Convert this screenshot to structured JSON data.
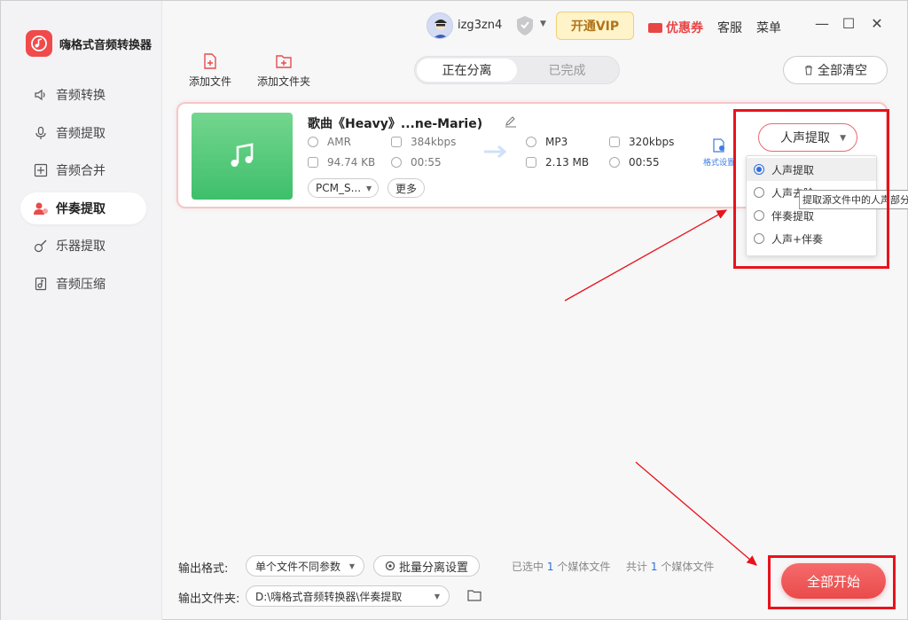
{
  "app": {
    "title": "嗨格式音频转换器"
  },
  "sidebar": {
    "items": [
      {
        "label": "音频转换",
        "icon": "speaker-icon"
      },
      {
        "label": "音频提取",
        "icon": "mic-icon"
      },
      {
        "label": "音频合并",
        "icon": "merge-icon"
      },
      {
        "label": "伴奏提取",
        "icon": "singer-icon",
        "active": true
      },
      {
        "label": "乐器提取",
        "icon": "guitar-icon"
      },
      {
        "label": "音频压缩",
        "icon": "compress-icon"
      }
    ]
  },
  "header": {
    "username": "izg3zn4",
    "vip_label": "开通VIP",
    "coupon_label": "优惠券",
    "service_label": "客服",
    "menu_label": "菜单"
  },
  "toolbar": {
    "add_file": "添加文件",
    "add_folder": "添加文件夹",
    "tabs": [
      "正在分离",
      "已完成"
    ],
    "active_tab": 0,
    "clear_all": "全部清空"
  },
  "file": {
    "name": "歌曲《Heavy》...ne-Marie)",
    "src_format": "AMR",
    "src_bitrate": "384kbps",
    "src_size": "94.74 KB",
    "src_duration": "00:55",
    "dst_format": "MP3",
    "dst_bitrate": "320kbps",
    "dst_size": "2.13 MB",
    "dst_duration": "00:55",
    "codec": "PCM_S...",
    "more": "更多",
    "format_settings": "格式设置",
    "mode": "人声提取"
  },
  "dropdown": {
    "options": [
      "人声提取",
      "人声去除",
      "伴奏提取",
      "人声+伴奏"
    ],
    "selected": 0,
    "tooltip": "提取源文件中的人声部分"
  },
  "footer": {
    "output_format_label": "输出格式:",
    "output_format_value": "单个文件不同参数",
    "batch_settings": "批量分离设置",
    "selected_prefix": "已选中",
    "selected_count": "1",
    "selected_suffix": "个媒体文件",
    "total_prefix": "共计",
    "total_count": "1",
    "total_suffix": "个媒体文件",
    "output_folder_label": "输出文件夹:",
    "output_folder_value": "D:\\嗨格式音频转换器\\伴奏提取",
    "start_all": "全部开始"
  },
  "colors": {
    "accent": "#ea4a4a",
    "annotation": "#e8131b",
    "link": "#2f6fe0"
  }
}
